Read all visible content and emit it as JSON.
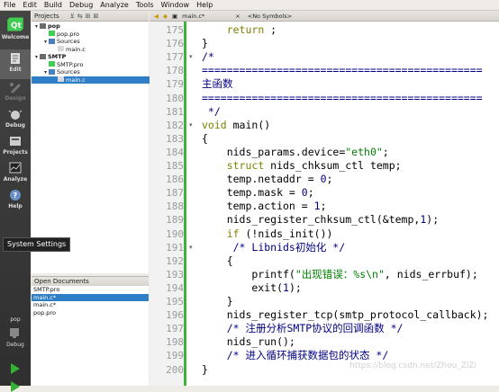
{
  "menu": [
    "File",
    "Edit",
    "Build",
    "Debug",
    "Analyze",
    "Tools",
    "Window",
    "Help"
  ],
  "modes": [
    {
      "label": "Welcome",
      "icon": "qt-logo-icon"
    },
    {
      "label": "Edit",
      "icon": "edit-icon"
    },
    {
      "label": "Design",
      "icon": "design-icon"
    },
    {
      "label": "Debug",
      "icon": "debug-icon"
    },
    {
      "label": "Projects",
      "icon": "projects-icon"
    },
    {
      "label": "Analyze",
      "icon": "analyze-icon"
    },
    {
      "label": "Help",
      "icon": "help-icon"
    }
  ],
  "projects_panel": {
    "title": "Projects",
    "tree": [
      {
        "label": "pop",
        "level": 0,
        "type": "project",
        "expanded": true
      },
      {
        "label": "pop.pro",
        "level": 1,
        "type": "pro"
      },
      {
        "label": "Sources",
        "level": 1,
        "type": "folder",
        "expanded": true
      },
      {
        "label": "main.c",
        "level": 2,
        "type": "c"
      },
      {
        "label": "SMTP",
        "level": 0,
        "type": "project",
        "expanded": true
      },
      {
        "label": "SMTP.pro",
        "level": 1,
        "type": "pro"
      },
      {
        "label": "Sources",
        "level": 1,
        "type": "folder",
        "expanded": true
      },
      {
        "label": "main.c",
        "level": 2,
        "type": "c",
        "selected": true
      }
    ]
  },
  "open_documents": {
    "title": "Open Documents",
    "items": [
      "SMTP.pro",
      "main.c*",
      "main.c*",
      "pop.pro"
    ],
    "selected_index": 1
  },
  "editor_toolbar": {
    "file": "main.c*",
    "symbols": "<No Symbols>"
  },
  "tooltip": "System Settings",
  "kit": {
    "project": "pop",
    "mode": "Debug"
  },
  "editor": {
    "lines": [
      {
        "n": "175",
        "fold": "",
        "tokens": [
          {
            "t": "    "
          },
          {
            "t": "return",
            "c": "kw"
          },
          {
            "t": " ;"
          }
        ]
      },
      {
        "n": "176",
        "fold": "",
        "tokens": [
          {
            "t": "}"
          }
        ]
      },
      {
        "n": "177",
        "fold": "▾",
        "tokens": [
          {
            "t": "/*",
            "c": "cmt"
          }
        ]
      },
      {
        "n": "178",
        "fold": "",
        "tokens": [
          {
            "t": "=============================================",
            "c": "cmt"
          }
        ]
      },
      {
        "n": "179",
        "fold": "",
        "tokens": [
          {
            "t": "主函数",
            "c": "cmt"
          }
        ]
      },
      {
        "n": "180",
        "fold": "",
        "tokens": [
          {
            "t": "=============================================",
            "c": "cmt"
          }
        ]
      },
      {
        "n": "181",
        "fold": "",
        "tokens": [
          {
            "t": " */",
            "c": "cmt"
          }
        ]
      },
      {
        "n": "182",
        "fold": "▾",
        "tokens": [
          {
            "t": "void",
            "c": "kw"
          },
          {
            "t": " main()"
          }
        ]
      },
      {
        "n": "183",
        "fold": "",
        "tokens": [
          {
            "t": "{"
          }
        ]
      },
      {
        "n": "184",
        "fold": "",
        "tokens": [
          {
            "t": "    nids_params.device="
          },
          {
            "t": "\"eth0\"",
            "c": "str"
          },
          {
            "t": ";"
          }
        ]
      },
      {
        "n": "185",
        "fold": "",
        "tokens": [
          {
            "t": "    "
          },
          {
            "t": "struct",
            "c": "kw"
          },
          {
            "t": " nids_chksum_ctl temp;"
          }
        ]
      },
      {
        "n": "186",
        "fold": "",
        "tokens": [
          {
            "t": "    temp.netaddr = "
          },
          {
            "t": "0",
            "c": "num"
          },
          {
            "t": ";"
          }
        ]
      },
      {
        "n": "187",
        "fold": "",
        "tokens": [
          {
            "t": "    temp.mask = "
          },
          {
            "t": "0",
            "c": "num"
          },
          {
            "t": ";"
          }
        ]
      },
      {
        "n": "188",
        "fold": "",
        "tokens": [
          {
            "t": "    temp.action = "
          },
          {
            "t": "1",
            "c": "num"
          },
          {
            "t": ";"
          }
        ]
      },
      {
        "n": "189",
        "fold": "",
        "tokens": [
          {
            "t": "    nids_register_chksum_ctl(&temp,"
          },
          {
            "t": "1",
            "c": "num"
          },
          {
            "t": ");"
          }
        ]
      },
      {
        "n": "190",
        "fold": "",
        "tokens": [
          {
            "t": "    "
          },
          {
            "t": "if",
            "c": "kw"
          },
          {
            "t": " (!nids_init())"
          }
        ]
      },
      {
        "n": "191",
        "fold": "▾",
        "tokens": [
          {
            "t": "     "
          },
          {
            "t": "/* Libnids初始化 */",
            "c": "cmt"
          }
        ]
      },
      {
        "n": "192",
        "fold": "",
        "tokens": [
          {
            "t": "    {"
          }
        ]
      },
      {
        "n": "193",
        "fold": "",
        "tokens": [
          {
            "t": "        printf("
          },
          {
            "t": "\"出现错误：%s\\n\"",
            "c": "str"
          },
          {
            "t": ", nids_errbuf);"
          }
        ]
      },
      {
        "n": "194",
        "fold": "",
        "tokens": [
          {
            "t": "        exit("
          },
          {
            "t": "1",
            "c": "num"
          },
          {
            "t": ");"
          }
        ]
      },
      {
        "n": "195",
        "fold": "",
        "tokens": [
          {
            "t": "    }"
          }
        ]
      },
      {
        "n": "196",
        "fold": "",
        "tokens": [
          {
            "t": "    nids_register_tcp(smtp_protocol_callback);"
          }
        ]
      },
      {
        "n": "197",
        "fold": "",
        "tokens": [
          {
            "t": "    "
          },
          {
            "t": "/* 注册分析SMTP协议的回调函数 */",
            "c": "cmt"
          }
        ]
      },
      {
        "n": "198",
        "fold": "",
        "tokens": [
          {
            "t": "    nids_run();"
          }
        ]
      },
      {
        "n": "199",
        "fold": "",
        "tokens": [
          {
            "t": "    "
          },
          {
            "t": "/* 进入循环捕获数据包的状态 */",
            "c": "cmt"
          }
        ]
      },
      {
        "n": "200",
        "fold": "",
        "tokens": [
          {
            "t": "}"
          }
        ]
      }
    ]
  },
  "watermark": "https://blog.csdn.net/Zhou_ZiZi",
  "colors": {
    "selection": "#2f7fc6",
    "keyword": "#808000",
    "string": "#008000",
    "comment": "#000080",
    "change_bar": "#3fb13f"
  }
}
